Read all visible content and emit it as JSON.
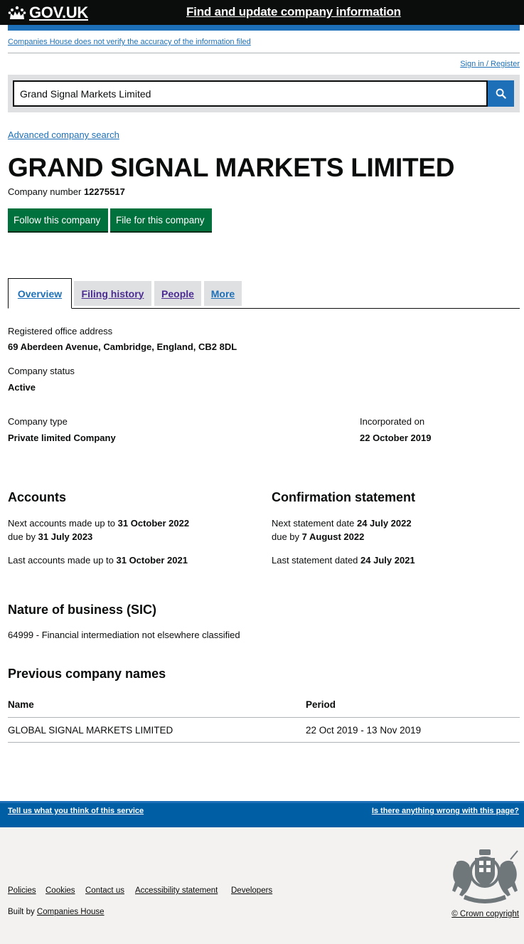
{
  "header": {
    "logo_text": "GOV.UK",
    "service_name": "Find and update company information"
  },
  "disclaimer": "Companies House does not verify the accuracy of the information filed",
  "signin": "Sign in / Register",
  "search": {
    "value": "Grand Signal Markets Limited",
    "icon": "search-icon"
  },
  "advanced_search": "Advanced company search",
  "company": {
    "name": "GRAND SIGNAL MARKETS LIMITED",
    "number_label": "Company number",
    "number": "12275517"
  },
  "buttons": {
    "follow": "Follow this company",
    "file": "File for this company"
  },
  "tabs": [
    {
      "label": "Overview",
      "active": true
    },
    {
      "label": "Filing history",
      "active": false
    },
    {
      "label": "People",
      "active": false
    },
    {
      "label": "More",
      "active": false
    }
  ],
  "overview": {
    "office_label": "Registered office address",
    "office_value": "69 Aberdeen Avenue, Cambridge, England, CB2 8DL",
    "status_label": "Company status",
    "status_value": "Active",
    "type_label": "Company type",
    "type_value": "Private limited Company",
    "incorporated_label": "Incorporated on",
    "incorporated_value": "22 October 2019"
  },
  "accounts": {
    "heading": "Accounts",
    "next_label": "Next accounts made up to",
    "next_value": "31 October 2022",
    "due_label": "due by",
    "due_value": "31 July 2023",
    "last_label": "Last accounts made up to",
    "last_value": "31 October 2021"
  },
  "confirmation": {
    "heading": "Confirmation statement",
    "next_label": "Next statement date",
    "next_value": "24 July 2022",
    "due_label": "due by",
    "due_value": "7 August 2022",
    "last_label": "Last statement dated",
    "last_value": "24 July 2021"
  },
  "nature": {
    "heading": "Nature of business (SIC)",
    "value": "64999 - Financial intermediation not elsewhere classified"
  },
  "previous_names": {
    "heading": "Previous company names",
    "col_name": "Name",
    "col_period": "Period",
    "rows": [
      {
        "name": "GLOBAL SIGNAL MARKETS LIMITED",
        "period": "22 Oct 2019 - 13 Nov 2019"
      }
    ]
  },
  "feedback": {
    "left": "Tell us what you think of this service",
    "right": "Is there anything wrong with this page?"
  },
  "footer": {
    "links": [
      "Policies",
      "Cookies",
      "Contact us",
      "Accessibility statement",
      "Developers"
    ],
    "built_by_prefix": "Built by",
    "built_by_link": "Companies House",
    "copyright": "© Crown copyright"
  },
  "colors": {
    "header_bg": "#0b0c0c",
    "brand_blue": "#1d70b8",
    "button_green": "#00703c",
    "tab_purple": "#4c2c92",
    "footer_bg": "#f3f2f1"
  }
}
